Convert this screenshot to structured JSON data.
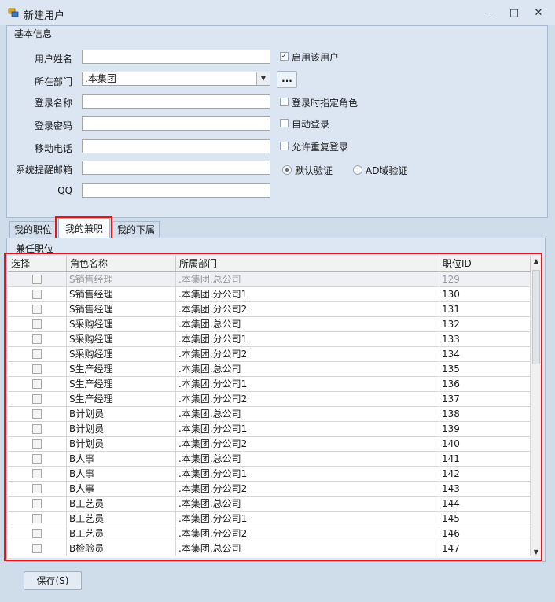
{
  "window": {
    "title": "新建用户",
    "minimize_glyph": "–",
    "maximize_glyph": "□",
    "close_glyph": "✕"
  },
  "basic_info": {
    "title": "基本信息",
    "labels": {
      "user_name": "用户姓名",
      "department": "所在部门",
      "login_name": "登录名称",
      "password": "登录密码",
      "mobile": "移动电话",
      "email": "系统提醒邮箱",
      "qq": "QQ"
    },
    "values": {
      "user_name": "",
      "department": ".本集团",
      "login_name": "",
      "password": "",
      "mobile": "",
      "email": "",
      "qq": ""
    },
    "browse_label": "...",
    "options": {
      "enable_user": {
        "label": "启用该用户",
        "checked": true
      },
      "assign_role_on_login": {
        "label": "登录时指定角色",
        "checked": false
      },
      "auto_login": {
        "label": "自动登录",
        "checked": false
      },
      "allow_repeat_login": {
        "label": "允许重复登录",
        "checked": false
      }
    },
    "auth": {
      "default_label": "默认验证",
      "ad_label": "AD域验证",
      "selected": "default"
    }
  },
  "tabs": [
    {
      "label": "我的职位",
      "active": false
    },
    {
      "label": "我的兼职",
      "active": true
    },
    {
      "label": "我的下属",
      "active": false
    }
  ],
  "tab_content": {
    "section_title": "兼任职位",
    "columns": [
      "选择",
      "角色名称",
      "所属部门",
      "职位ID"
    ],
    "rows": [
      {
        "role": "S销售经理",
        "dept": ".本集团.总公司",
        "id": "129"
      },
      {
        "role": "S销售经理",
        "dept": ".本集团.分公司1",
        "id": "130"
      },
      {
        "role": "S销售经理",
        "dept": ".本集团.分公司2",
        "id": "131"
      },
      {
        "role": "S采购经理",
        "dept": ".本集团.总公司",
        "id": "132"
      },
      {
        "role": "S采购经理",
        "dept": ".本集团.分公司1",
        "id": "133"
      },
      {
        "role": "S采购经理",
        "dept": ".本集团.分公司2",
        "id": "134"
      },
      {
        "role": "S生产经理",
        "dept": ".本集团.总公司",
        "id": "135"
      },
      {
        "role": "S生产经理",
        "dept": ".本集团.分公司1",
        "id": "136"
      },
      {
        "role": "S生产经理",
        "dept": ".本集团.分公司2",
        "id": "137"
      },
      {
        "role": "B计划员",
        "dept": ".本集团.总公司",
        "id": "138"
      },
      {
        "role": "B计划员",
        "dept": ".本集团.分公司1",
        "id": "139"
      },
      {
        "role": "B计划员",
        "dept": ".本集团.分公司2",
        "id": "140"
      },
      {
        "role": "B人事",
        "dept": ".本集团.总公司",
        "id": "141"
      },
      {
        "role": "B人事",
        "dept": ".本集团.分公司1",
        "id": "142"
      },
      {
        "role": "B人事",
        "dept": ".本集团.分公司2",
        "id": "143"
      },
      {
        "role": "B工艺员",
        "dept": ".本集团.总公司",
        "id": "144"
      },
      {
        "role": "B工艺员",
        "dept": ".本集团.分公司1",
        "id": "145"
      },
      {
        "role": "B工艺员",
        "dept": ".本集团.分公司2",
        "id": "146"
      },
      {
        "role": "B检验员",
        "dept": ".本集团.总公司",
        "id": "147"
      }
    ]
  },
  "footer": {
    "save_label": "保存(S)"
  },
  "colors": {
    "highlight_border": "#e31515",
    "window_bg": "#cfdcea"
  }
}
